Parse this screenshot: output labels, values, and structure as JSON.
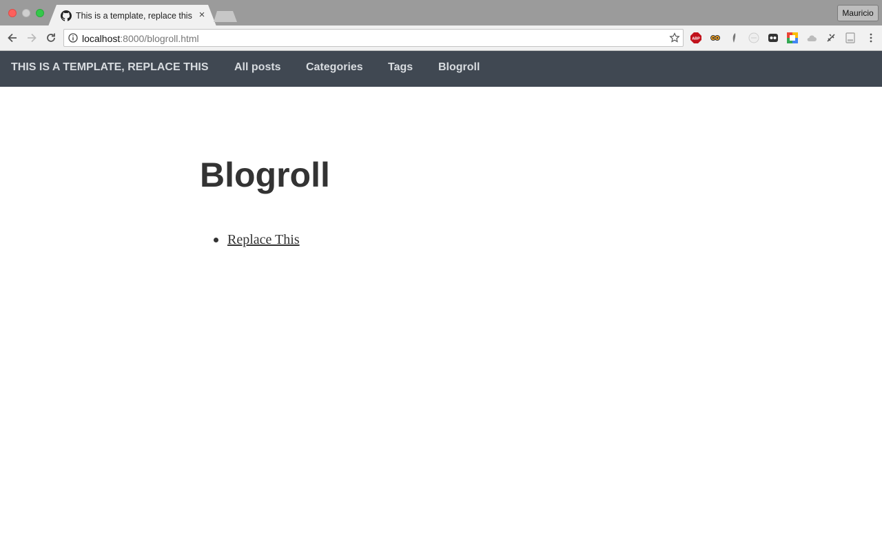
{
  "browser": {
    "tab_title": "This is a template, replace this",
    "tab_close": "×",
    "profile_name": "Mauricio",
    "url_host": "localhost",
    "url_path": ":8000/blogroll.html"
  },
  "site": {
    "brand": "THIS IS A TEMPLATE, REPLACE THIS",
    "nav": [
      {
        "label": "All posts"
      },
      {
        "label": "Categories"
      },
      {
        "label": "Tags"
      },
      {
        "label": "Blogroll"
      }
    ]
  },
  "page": {
    "title": "Blogroll",
    "links": [
      {
        "label": "Replace This"
      }
    ]
  },
  "colors": {
    "nav_bg": "#404852",
    "nav_text": "#d8dce0",
    "heading": "#333333"
  }
}
